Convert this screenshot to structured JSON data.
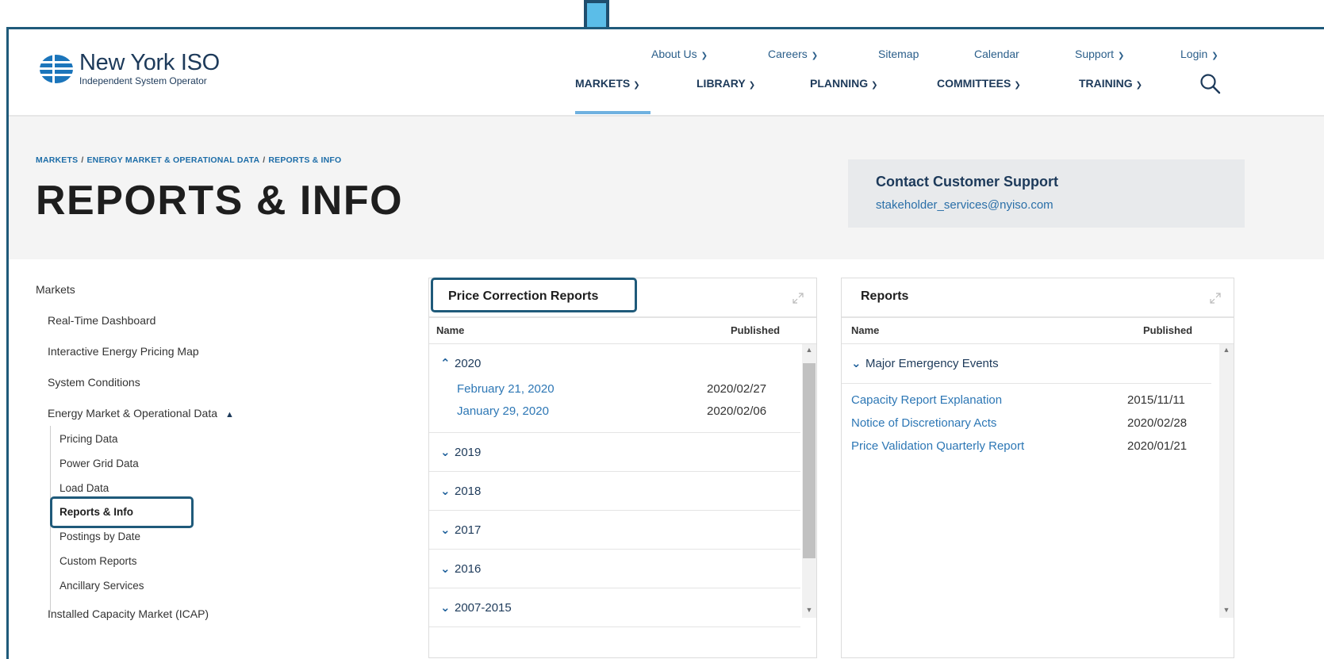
{
  "header": {
    "logo_name": "New York ISO",
    "logo_sub": "Independent System Operator",
    "util_nav": [
      "About Us",
      "Careers",
      "Sitemap",
      "Calendar",
      "Support",
      "Login"
    ],
    "main_nav": [
      "MARKETS",
      "LIBRARY",
      "PLANNING",
      "COMMITTEES",
      "TRAINING"
    ],
    "active": "MARKETS"
  },
  "breadcrumb": [
    "MARKETS",
    "ENERGY MARKET & OPERATIONAL DATA",
    "REPORTS & INFO"
  ],
  "page_title": "REPORTS & INFO",
  "contact": {
    "title": "Contact Customer Support",
    "email": "stakeholder_services@nyiso.com"
  },
  "sidebar": {
    "root": "Markets",
    "items": [
      "Real-Time Dashboard",
      "Interactive Energy Pricing Map",
      "System Conditions",
      "Energy Market & Operational Data"
    ],
    "subitems": [
      "Pricing Data",
      "Power Grid Data",
      "Load Data",
      "Reports & Info",
      "Postings by Date",
      "Custom Reports",
      "Ancillary Services"
    ],
    "after": "Installed Capacity Market (ICAP)"
  },
  "panel_left": {
    "title": "Price Correction Reports",
    "col_name": "Name",
    "col_published": "Published",
    "years": [
      "2020",
      "2019",
      "2018",
      "2017",
      "2016",
      "2007-2015"
    ],
    "docs": [
      {
        "name": "February 21, 2020",
        "date": "2020/02/27"
      },
      {
        "name": "January 29, 2020",
        "date": "2020/02/06"
      }
    ]
  },
  "panel_right": {
    "title": "Reports",
    "col_name": "Name",
    "col_published": "Published",
    "group": "Major Emergency Events",
    "docs": [
      {
        "name": "Capacity Report Explanation",
        "date": "2015/11/11"
      },
      {
        "name": "Notice of Discretionary Acts",
        "date": "2020/02/28"
      },
      {
        "name": "Price Validation Quarterly Report",
        "date": "2020/01/21"
      }
    ]
  },
  "colors": {
    "brand_navy": "#1d3a5a",
    "link_blue": "#2d77b5",
    "highlight_border": "#1f5a7a",
    "arrow_fill": "#5bbde8"
  }
}
